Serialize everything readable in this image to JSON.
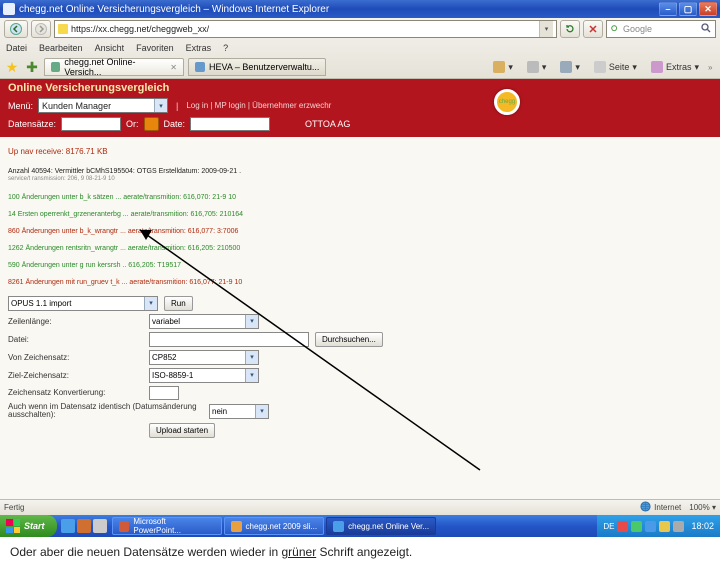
{
  "window": {
    "title": "chegg.net Online Versicherungsvergleich – Windows Internet Explorer"
  },
  "nav": {
    "address": "https://xx.chegg.net/cheggweb_xx/",
    "search_placeholder": "Google"
  },
  "menus": {
    "items": [
      "Datei",
      "Bearbeiten",
      "Ansicht",
      "Favoriten",
      "Extras",
      "?"
    ]
  },
  "tabs": [
    {
      "label": "chegg.net Online-Versich..."
    },
    {
      "label": "HEVA – Benutzerverwaltu..."
    }
  ],
  "fav_tools": {
    "home": "",
    "print": "",
    "page": "Seite",
    "extras": "Extras"
  },
  "header": {
    "app_title": "Online Versicherungsvergleich",
    "menu_label": "Menü:",
    "menu_value": "Kunden Manager",
    "links": "Log in | MP login | Übernehmer erzwechr",
    "search_label": "Datensätze:",
    "or_label": "Or:",
    "date_label": "Date:",
    "company": "OTTOA AG",
    "badge": "chegg"
  },
  "content": {
    "upload_info": "Up nav receive: 8176.71 KB",
    "black1": "Anzahl 40594: Vermittler bCMhS195504: OTGS Erstelldatum: 2009-09-21 .",
    "black1_sub": "service/t ransmission: 206, 9 08-21-9 10",
    "lines": [
      {
        "cls": "green-line",
        "text": "100 Änderungen unter b_k sätzen ... aerate/transmition: 616,070: 21-9 10"
      },
      {
        "cls": "green-line",
        "text": "14 Ersten operrenkt_grzeneranterbg ... aerate/transmition: 616,705: 210164"
      },
      {
        "cls": "red-line",
        "text": "860 Änderungen unter b_k_wrangtr ... aerate/transmition: 616,077: 3:7006"
      },
      {
        "cls": "green-line",
        "text": "1262 Änderungen rentsritn_wrangtr ... aerate/transmition: 616,205: 210500"
      },
      {
        "cls": "green-line",
        "text": "590 Änderungen unter g run kersrsh .. 616,205: T19517"
      },
      {
        "cls": "red-line",
        "text": "8261 Änderungen mit run_gruev t_k ... aerate/transmition: 616,077: 21-9 10"
      }
    ],
    "form": {
      "row1_select": "OPUS 1.1  import",
      "row1_btn": "Run",
      "zeilenlange_label": "Zeilenlänge:",
      "zeilenlange_value": "variabel",
      "datei_label": "Datei:",
      "durchsuchen_btn": "Durchsuchen...",
      "von_zs_label": "Von Zeichensatz:",
      "von_zs_value": "CP852",
      "ziel_zs_label": "Ziel-Zeichensatz:",
      "ziel_zs_value": "ISO-8859-1",
      "konv_label": "Zeichensatz Konvertierung:",
      "auch_label": "Auch wenn im Datensatz identisch (Datumsänderung ausschalten):",
      "auch_value": "nein",
      "upload_btn": "Upload starten"
    }
  },
  "status": {
    "left": "Fertig",
    "zone": "Internet",
    "zoom": "100%"
  },
  "taskbar": {
    "start": "Start",
    "items": [
      "Microsoft PowerPoint...",
      "chegg.net   2009   sli...",
      "chegg.net Online Ver..."
    ],
    "lang": "DE",
    "clock": "18:02"
  },
  "caption": {
    "pre": "Oder aber die neuen Datensätze werden wieder in ",
    "word": "grüner",
    "post": " Schrift angezeigt."
  }
}
